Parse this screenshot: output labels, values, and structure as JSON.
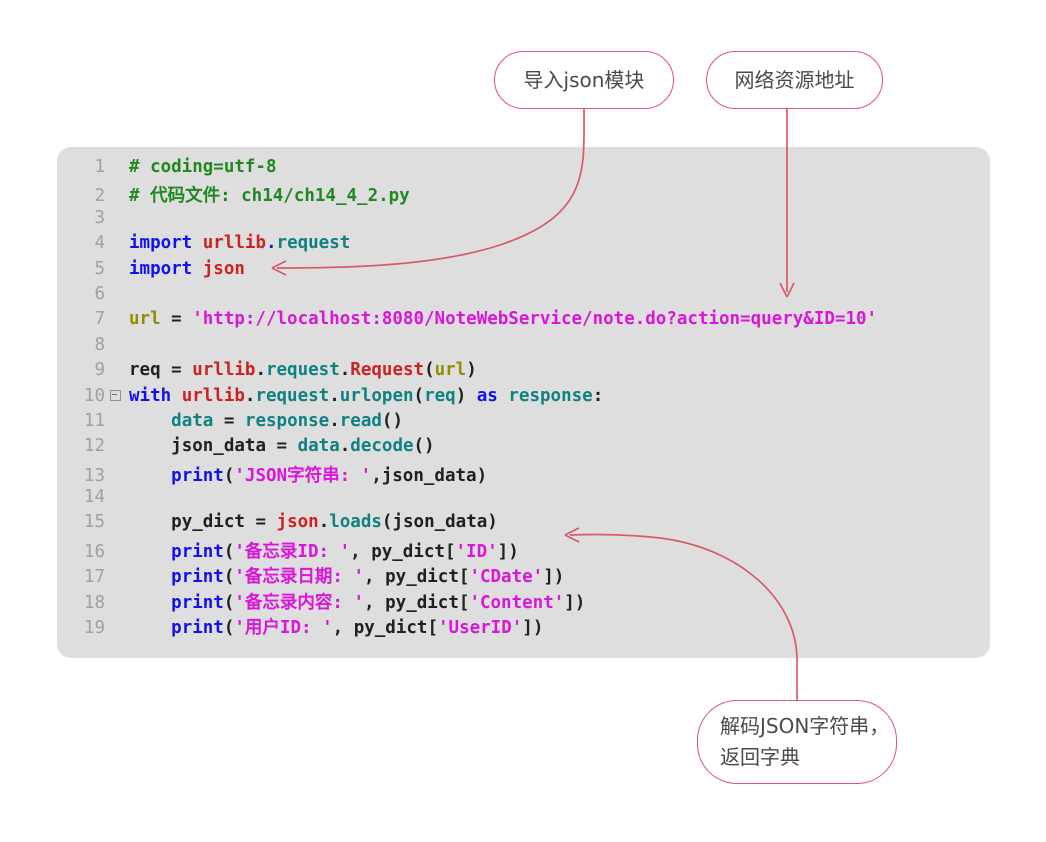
{
  "code": {
    "language": "python",
    "lines": [
      {
        "num": "1",
        "fold": false,
        "tokens": [
          {
            "text": "# coding=utf-8",
            "cls": "t-comment"
          }
        ]
      },
      {
        "num": "2",
        "fold": false,
        "tokens": [
          {
            "text": "# 代码文件: ch14/ch14_4_2.py",
            "cls": "t-comment"
          }
        ]
      },
      {
        "num": "3",
        "fold": false,
        "tokens": []
      },
      {
        "num": "4",
        "fold": false,
        "tokens": [
          {
            "text": "import ",
            "cls": "t-kw"
          },
          {
            "text": "urllib",
            "cls": "t-mod"
          },
          {
            "text": ".",
            "cls": "t-kw"
          },
          {
            "text": "request",
            "cls": "t-attr"
          }
        ]
      },
      {
        "num": "5",
        "fold": false,
        "tokens": [
          {
            "text": "import ",
            "cls": "t-kw"
          },
          {
            "text": "json",
            "cls": "t-mod"
          }
        ]
      },
      {
        "num": "6",
        "fold": false,
        "tokens": []
      },
      {
        "num": "7",
        "fold": false,
        "tokens": [
          {
            "text": "url",
            "cls": "t-var"
          },
          {
            "text": " = ",
            "cls": "t-op"
          },
          {
            "text": "'http://localhost:8080/NoteWebService/note.do?action=query&ID=10'",
            "cls": "t-str"
          }
        ]
      },
      {
        "num": "8",
        "fold": false,
        "tokens": []
      },
      {
        "num": "9",
        "fold": false,
        "tokens": [
          {
            "text": "req",
            "cls": "t-plain"
          },
          {
            "text": " = ",
            "cls": "t-op"
          },
          {
            "text": "urllib",
            "cls": "t-mod"
          },
          {
            "text": ".",
            "cls": "t-punc"
          },
          {
            "text": "request",
            "cls": "t-attr"
          },
          {
            "text": ".",
            "cls": "t-punc"
          },
          {
            "text": "Request",
            "cls": "t-mod"
          },
          {
            "text": "(",
            "cls": "t-punc"
          },
          {
            "text": "url",
            "cls": "t-var"
          },
          {
            "text": ")",
            "cls": "t-punc"
          }
        ]
      },
      {
        "num": "10",
        "fold": true,
        "tokens": [
          {
            "text": "with ",
            "cls": "t-kw"
          },
          {
            "text": "urllib",
            "cls": "t-mod"
          },
          {
            "text": ".",
            "cls": "t-punc"
          },
          {
            "text": "request",
            "cls": "t-attr"
          },
          {
            "text": ".",
            "cls": "t-punc"
          },
          {
            "text": "urlopen",
            "cls": "t-attr"
          },
          {
            "text": "(",
            "cls": "t-punc"
          },
          {
            "text": "req",
            "cls": "t-attr"
          },
          {
            "text": ") ",
            "cls": "t-punc"
          },
          {
            "text": "as",
            "cls": "t-kw"
          },
          {
            "text": " ",
            "cls": "t-punc"
          },
          {
            "text": "response",
            "cls": "t-attr"
          },
          {
            "text": ":",
            "cls": "t-punc"
          }
        ]
      },
      {
        "num": "11",
        "fold": false,
        "tokens": [
          {
            "text": "    ",
            "cls": "t-plain"
          },
          {
            "text": "data",
            "cls": "t-attr"
          },
          {
            "text": " = ",
            "cls": "t-op"
          },
          {
            "text": "response",
            "cls": "t-attr"
          },
          {
            "text": ".",
            "cls": "t-punc"
          },
          {
            "text": "read",
            "cls": "t-attr"
          },
          {
            "text": "()",
            "cls": "t-punc"
          }
        ]
      },
      {
        "num": "12",
        "fold": false,
        "tokens": [
          {
            "text": "    ",
            "cls": "t-plain"
          },
          {
            "text": "json_data",
            "cls": "t-plain"
          },
          {
            "text": " = ",
            "cls": "t-op"
          },
          {
            "text": "data",
            "cls": "t-attr"
          },
          {
            "text": ".",
            "cls": "t-punc"
          },
          {
            "text": "decode",
            "cls": "t-attr"
          },
          {
            "text": "()",
            "cls": "t-punc"
          }
        ]
      },
      {
        "num": "13",
        "fold": false,
        "tokens": [
          {
            "text": "    ",
            "cls": "t-plain"
          },
          {
            "text": "print",
            "cls": "t-kw"
          },
          {
            "text": "(",
            "cls": "t-punc"
          },
          {
            "text": "'JSON字符串: '",
            "cls": "t-str"
          },
          {
            "text": ",",
            "cls": "t-punc"
          },
          {
            "text": "json_data",
            "cls": "t-plain"
          },
          {
            "text": ")",
            "cls": "t-punc"
          }
        ]
      },
      {
        "num": "14",
        "fold": false,
        "tokens": []
      },
      {
        "num": "15",
        "fold": false,
        "tokens": [
          {
            "text": "    ",
            "cls": "t-plain"
          },
          {
            "text": "py_dict",
            "cls": "t-plain"
          },
          {
            "text": " = ",
            "cls": "t-op"
          },
          {
            "text": "json",
            "cls": "t-mod"
          },
          {
            "text": ".",
            "cls": "t-punc"
          },
          {
            "text": "loads",
            "cls": "t-attr"
          },
          {
            "text": "(",
            "cls": "t-punc"
          },
          {
            "text": "json_data",
            "cls": "t-plain"
          },
          {
            "text": ")",
            "cls": "t-punc"
          }
        ]
      },
      {
        "num": "16",
        "fold": false,
        "tokens": [
          {
            "text": "    ",
            "cls": "t-plain"
          },
          {
            "text": "print",
            "cls": "t-kw"
          },
          {
            "text": "(",
            "cls": "t-punc"
          },
          {
            "text": "'备忘录ID: '",
            "cls": "t-str"
          },
          {
            "text": ", ",
            "cls": "t-punc"
          },
          {
            "text": "py_dict",
            "cls": "t-plain"
          },
          {
            "text": "[",
            "cls": "t-punc"
          },
          {
            "text": "'ID'",
            "cls": "t-str"
          },
          {
            "text": "])",
            "cls": "t-punc"
          }
        ]
      },
      {
        "num": "17",
        "fold": false,
        "tokens": [
          {
            "text": "    ",
            "cls": "t-plain"
          },
          {
            "text": "print",
            "cls": "t-kw"
          },
          {
            "text": "(",
            "cls": "t-punc"
          },
          {
            "text": "'备忘录日期: '",
            "cls": "t-str"
          },
          {
            "text": ", ",
            "cls": "t-punc"
          },
          {
            "text": "py_dict",
            "cls": "t-plain"
          },
          {
            "text": "[",
            "cls": "t-punc"
          },
          {
            "text": "'CDate'",
            "cls": "t-str"
          },
          {
            "text": "])",
            "cls": "t-punc"
          }
        ]
      },
      {
        "num": "18",
        "fold": false,
        "tokens": [
          {
            "text": "    ",
            "cls": "t-plain"
          },
          {
            "text": "print",
            "cls": "t-kw"
          },
          {
            "text": "(",
            "cls": "t-punc"
          },
          {
            "text": "'备忘录内容: '",
            "cls": "t-str"
          },
          {
            "text": ", ",
            "cls": "t-punc"
          },
          {
            "text": "py_dict",
            "cls": "t-plain"
          },
          {
            "text": "[",
            "cls": "t-punc"
          },
          {
            "text": "'Content'",
            "cls": "t-str"
          },
          {
            "text": "])",
            "cls": "t-punc"
          }
        ]
      },
      {
        "num": "19",
        "fold": false,
        "tokens": [
          {
            "text": "    ",
            "cls": "t-plain"
          },
          {
            "text": "print",
            "cls": "t-kw"
          },
          {
            "text": "(",
            "cls": "t-punc"
          },
          {
            "text": "'用户ID: '",
            "cls": "t-str"
          },
          {
            "text": ", ",
            "cls": "t-punc"
          },
          {
            "text": "py_dict",
            "cls": "t-plain"
          },
          {
            "text": "[",
            "cls": "t-punc"
          },
          {
            "text": "'UserID'",
            "cls": "t-str"
          },
          {
            "text": "])",
            "cls": "t-punc"
          }
        ]
      }
    ]
  },
  "annotations": {
    "import_json": "导入json模块",
    "network_url": "网络资源地址",
    "decode_line1": "解码JSON字符串，",
    "decode_line2": "返回字典"
  },
  "colors": {
    "code_background": "#dedede",
    "page_background": "#ffffff",
    "annotation_stroke": "#d9596a",
    "comment": "#218821",
    "keyword": "#1111ee",
    "module": "#cc2222",
    "attribute": "#108080",
    "string": "#d916d9",
    "variable": "#8f8f00",
    "gutter": "#a0a0a0"
  }
}
